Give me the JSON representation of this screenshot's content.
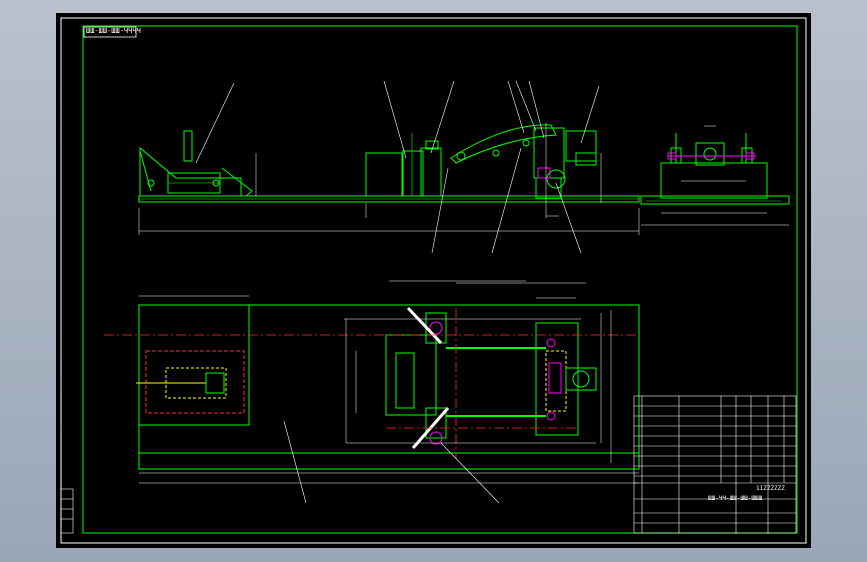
{
  "drawing": {
    "title_block_tag": "ШШ-ШШ-ШШ-ЧЧЧЧ",
    "drawing_code": "ШШ-ЧЧ-ШШ-ШШ-ШШШ",
    "drawing_name": "11ZZZZZZ"
  },
  "colors": {
    "background": "#000000",
    "frame": "#ffffff",
    "geometry": "#00ff00",
    "centerline": "#ff2a2a",
    "parts": "#ff00ff",
    "dimension": "#ffffff",
    "workspace": "#9aa6b7"
  },
  "icons": {
    "leader_balloon": "leader-line-icon"
  }
}
